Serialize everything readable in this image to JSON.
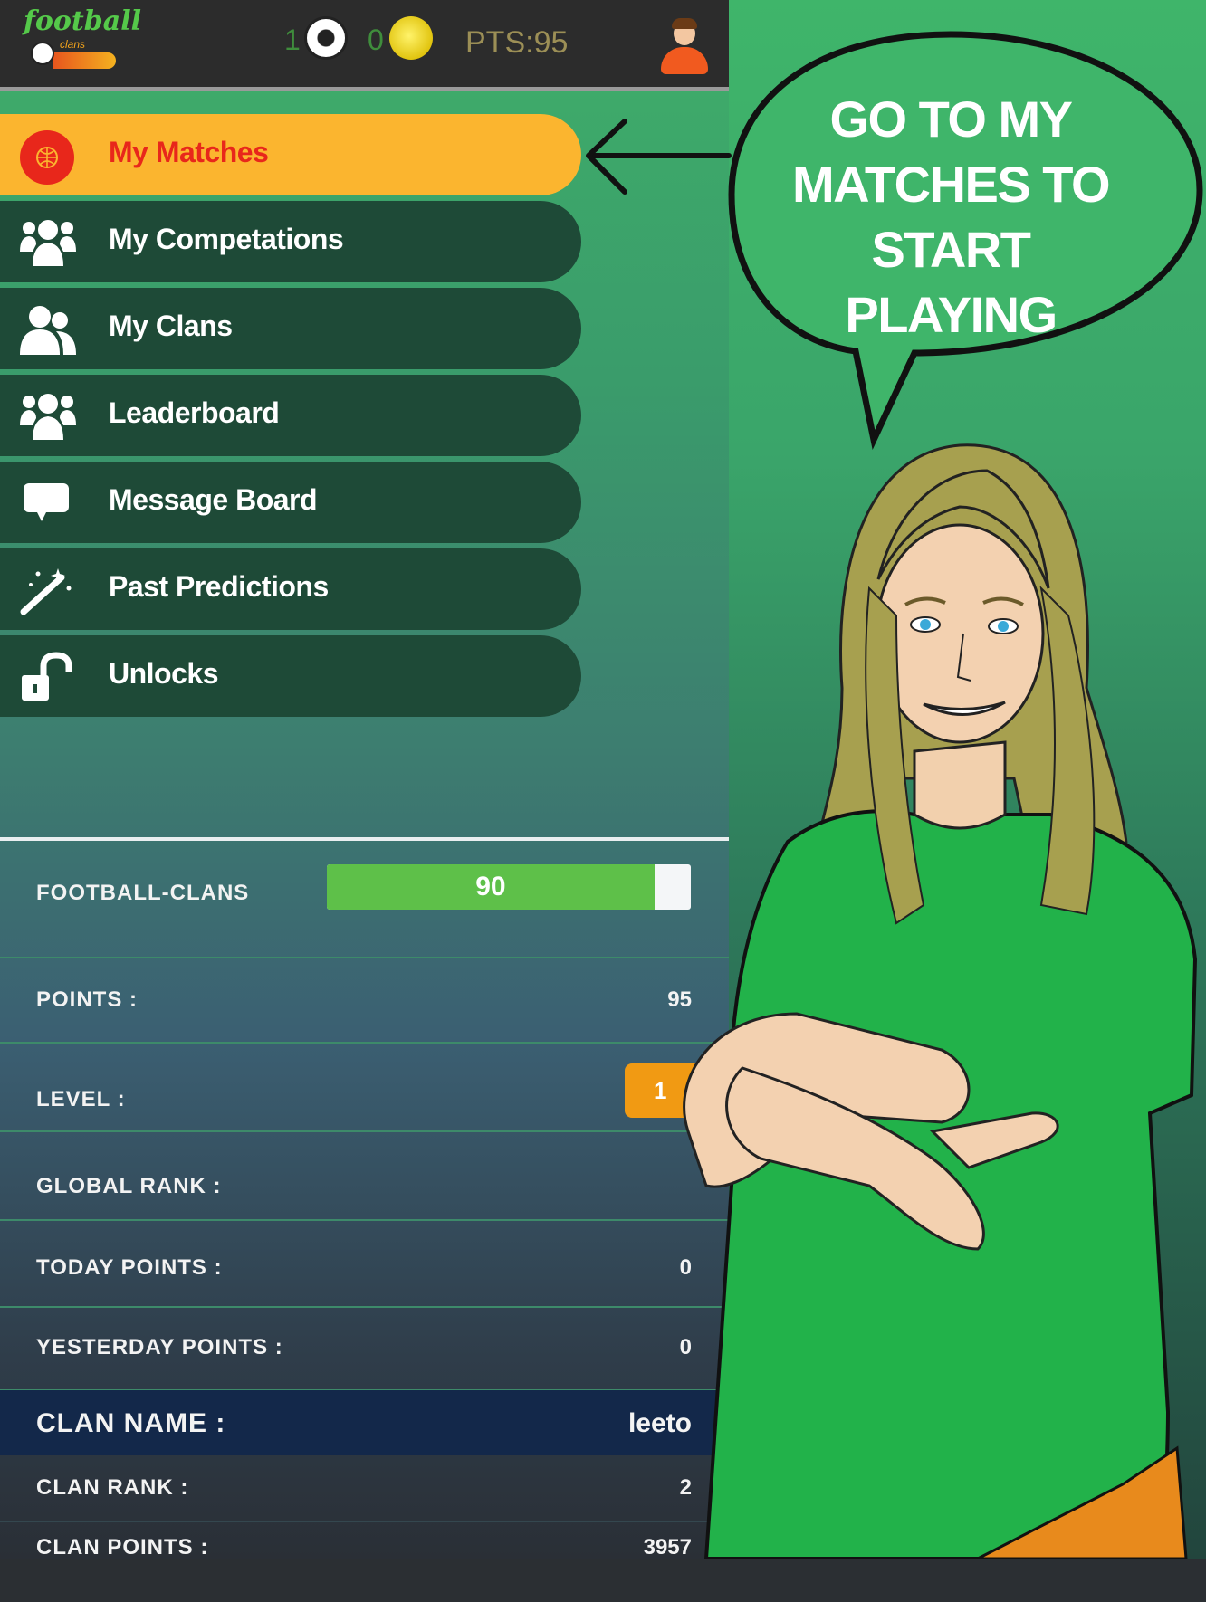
{
  "header": {
    "logo_text": "football",
    "logo_subtext": "clans",
    "soccer_count": "1",
    "coin_count": "0",
    "points": "PTS:95"
  },
  "menu": {
    "items": [
      {
        "label": "My Matches",
        "icon": "basketball-icon",
        "active": true
      },
      {
        "label": "My Competations",
        "icon": "group-icon"
      },
      {
        "label": "My Clans",
        "icon": "users-icon"
      },
      {
        "label": "Leaderboard",
        "icon": "group-icon"
      },
      {
        "label": "Message Board",
        "icon": "chat-bubble-icon"
      },
      {
        "label": "Past Predictions",
        "icon": "magic-wand-icon"
      },
      {
        "label": "Unlocks",
        "icon": "unlock-icon"
      }
    ]
  },
  "stats": {
    "football_clans_label": "FOOTBALL-CLANS",
    "football_clans_progress": 90,
    "football_clans_progress_text": "90",
    "points_label": "POINTS :",
    "points_value": "95",
    "level_label": "LEVEL :",
    "level_value": "1",
    "global_rank_label": "GLOBAL RANK :",
    "today_points_label": "TODAY POINTS :",
    "today_points_value": "0",
    "yesterday_points_label": "YESTERDAY POINTS :",
    "yesterday_points_value": "0",
    "clan_name_label": "CLAN NAME :",
    "clan_name_value": "leeto",
    "clan_rank_label": "CLAN RANK :",
    "clan_rank_value": "2",
    "clan_points_label": "CLAN POINTS :",
    "clan_points_value": "3957"
  },
  "callout": {
    "line1": "GO TO MY",
    "line2": "MATCHES TO",
    "line3": "START PLAYING"
  },
  "colors": {
    "accent_active": "#fbb52f",
    "menu_bg": "#1e4a37",
    "active_label": "#e8271b",
    "progress_fill": "#5ec049",
    "level_badge": "#f19a13",
    "shirt": "#22b24a"
  }
}
